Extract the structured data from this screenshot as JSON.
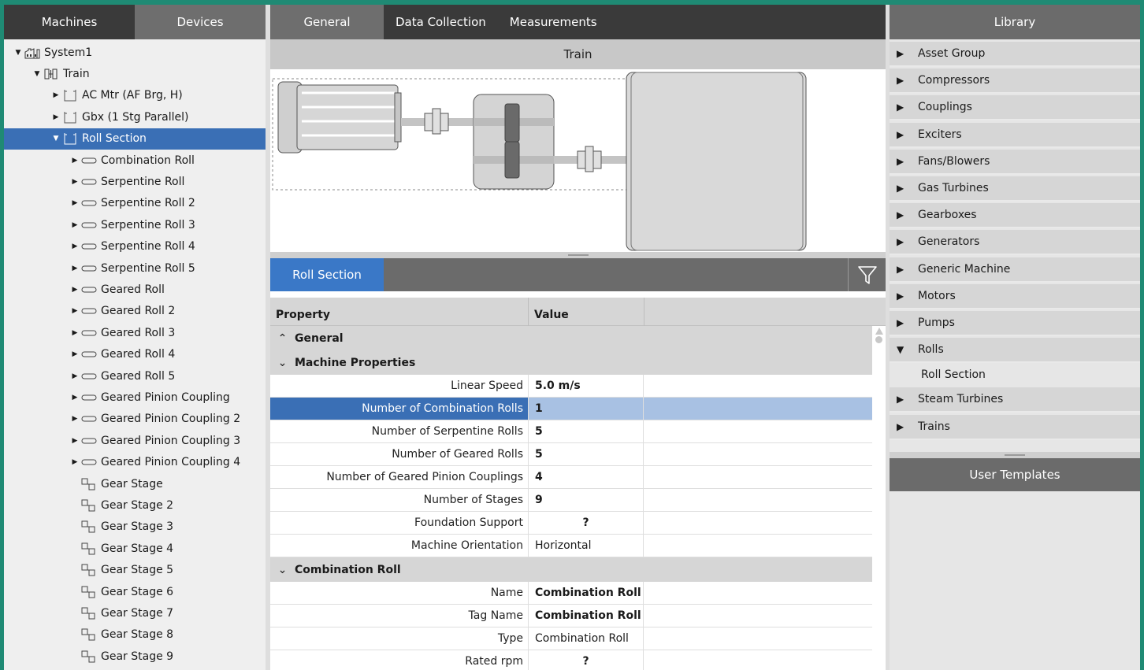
{
  "left": {
    "tabs": [
      {
        "label": "Machines",
        "active": false
      },
      {
        "label": "Devices",
        "active": true
      }
    ],
    "tree": [
      {
        "label": "System1",
        "level": 0,
        "arrow": "▼",
        "icon": "factory-icon"
      },
      {
        "label": "Train",
        "level": 1,
        "arrow": "▼",
        "icon": "train-icon"
      },
      {
        "label": "AC Mtr (AF Brg, H)",
        "level": 2,
        "arrow": "▶",
        "icon": "machine-icon"
      },
      {
        "label": "Gbx (1 Stg Parallel)",
        "level": 2,
        "arrow": "▶",
        "icon": "machine-icon"
      },
      {
        "label": "Roll Section",
        "level": 2,
        "arrow": "▼",
        "icon": "machine-icon",
        "selected": true
      },
      {
        "label": "Combination Roll",
        "level": 3,
        "arrow": "▶",
        "icon": "roll-icon"
      },
      {
        "label": "Serpentine Roll",
        "level": 3,
        "arrow": "▶",
        "icon": "roll-icon"
      },
      {
        "label": "Serpentine Roll 2",
        "level": 3,
        "arrow": "▶",
        "icon": "roll-icon"
      },
      {
        "label": "Serpentine Roll 3",
        "level": 3,
        "arrow": "▶",
        "icon": "roll-icon"
      },
      {
        "label": "Serpentine Roll 4",
        "level": 3,
        "arrow": "▶",
        "icon": "roll-icon"
      },
      {
        "label": "Serpentine Roll 5",
        "level": 3,
        "arrow": "▶",
        "icon": "roll-icon"
      },
      {
        "label": "Geared Roll",
        "level": 3,
        "arrow": "▶",
        "icon": "roll-icon"
      },
      {
        "label": "Geared Roll 2",
        "level": 3,
        "arrow": "▶",
        "icon": "roll-icon"
      },
      {
        "label": "Geared Roll 3",
        "level": 3,
        "arrow": "▶",
        "icon": "roll-icon"
      },
      {
        "label": "Geared Roll 4",
        "level": 3,
        "arrow": "▶",
        "icon": "roll-icon"
      },
      {
        "label": "Geared Roll 5",
        "level": 3,
        "arrow": "▶",
        "icon": "roll-icon"
      },
      {
        "label": "Geared Pinion Coupling",
        "level": 3,
        "arrow": "▶",
        "icon": "roll-icon"
      },
      {
        "label": "Geared Pinion Coupling 2",
        "level": 3,
        "arrow": "▶",
        "icon": "roll-icon"
      },
      {
        "label": "Geared Pinion Coupling 3",
        "level": 3,
        "arrow": "▶",
        "icon": "roll-icon"
      },
      {
        "label": "Geared Pinion Coupling 4",
        "level": 3,
        "arrow": "▶",
        "icon": "roll-icon"
      },
      {
        "label": "Gear Stage",
        "level": 3,
        "arrow": "",
        "icon": "gear-stage-icon"
      },
      {
        "label": "Gear Stage 2",
        "level": 3,
        "arrow": "",
        "icon": "gear-stage-icon"
      },
      {
        "label": "Gear Stage 3",
        "level": 3,
        "arrow": "",
        "icon": "gear-stage-icon"
      },
      {
        "label": "Gear Stage 4",
        "level": 3,
        "arrow": "",
        "icon": "gear-stage-icon"
      },
      {
        "label": "Gear Stage 5",
        "level": 3,
        "arrow": "",
        "icon": "gear-stage-icon"
      },
      {
        "label": "Gear Stage 6",
        "level": 3,
        "arrow": "",
        "icon": "gear-stage-icon"
      },
      {
        "label": "Gear Stage 7",
        "level": 3,
        "arrow": "",
        "icon": "gear-stage-icon"
      },
      {
        "label": "Gear Stage 8",
        "level": 3,
        "arrow": "",
        "icon": "gear-stage-icon"
      },
      {
        "label": "Gear Stage 9",
        "level": 3,
        "arrow": "",
        "icon": "gear-stage-icon"
      }
    ]
  },
  "center": {
    "tabs": [
      {
        "label": "General",
        "active": true
      },
      {
        "label": "Data Collection",
        "active": false
      },
      {
        "label": "Measurements",
        "active": false
      }
    ],
    "diagram_title": "Train",
    "section_tab": "Roll Section",
    "grid": {
      "headers": {
        "property": "Property",
        "value": "Value"
      },
      "groups": [
        {
          "title": "General",
          "chevron": "up",
          "rows": []
        },
        {
          "title": "Machine Properties",
          "chevron": "down",
          "rows": [
            {
              "label": "Linear Speed",
              "value": "5.0 m/s",
              "style": "bold"
            },
            {
              "label": "Number of Combination Rolls",
              "value": "1",
              "style": "bold",
              "selected": true
            },
            {
              "label": "Number of Serpentine Rolls",
              "value": "5",
              "style": "bold"
            },
            {
              "label": "Number of Geared Rolls",
              "value": "5",
              "style": "bold"
            },
            {
              "label": "Number of Geared Pinion Couplings",
              "value": "4",
              "style": "bold"
            },
            {
              "label": "Number of Stages",
              "value": "9",
              "style": "bold"
            },
            {
              "label": "Foundation Support",
              "value": "?",
              "style": "q"
            },
            {
              "label": "Machine Orientation",
              "value": "Horizontal",
              "style": "normal"
            }
          ]
        },
        {
          "title": "Combination Roll",
          "chevron": "down",
          "rows": [
            {
              "label": "Name",
              "value": "Combination Roll",
              "style": "bold"
            },
            {
              "label": "Tag Name",
              "value": "Combination Roll",
              "style": "bold"
            },
            {
              "label": "Type",
              "value": "Combination Roll",
              "style": "normal"
            },
            {
              "label": "Rated rpm",
              "value": "?",
              "style": "q"
            }
          ]
        }
      ]
    }
  },
  "right": {
    "library_title": "Library",
    "items": [
      {
        "label": "Asset Group",
        "expanded": false
      },
      {
        "label": "Compressors",
        "expanded": false
      },
      {
        "label": "Couplings",
        "expanded": false
      },
      {
        "label": "Exciters",
        "expanded": false
      },
      {
        "label": "Fans/Blowers",
        "expanded": false
      },
      {
        "label": "Gas Turbines",
        "expanded": false
      },
      {
        "label": "Gearboxes",
        "expanded": false
      },
      {
        "label": "Generators",
        "expanded": false
      },
      {
        "label": "Generic Machine",
        "expanded": false
      },
      {
        "label": "Motors",
        "expanded": false
      },
      {
        "label": "Pumps",
        "expanded": false
      },
      {
        "label": "Rolls",
        "expanded": true,
        "children": [
          "Roll Section"
        ]
      },
      {
        "label": "Steam Turbines",
        "expanded": false
      },
      {
        "label": "Trains",
        "expanded": false
      }
    ],
    "user_templates_title": "User Templates"
  },
  "colors": {
    "accent": "#3a78c7",
    "selected": "#3a6fb5",
    "selected_light": "#a8c1e3",
    "frame": "#1f8a74"
  }
}
